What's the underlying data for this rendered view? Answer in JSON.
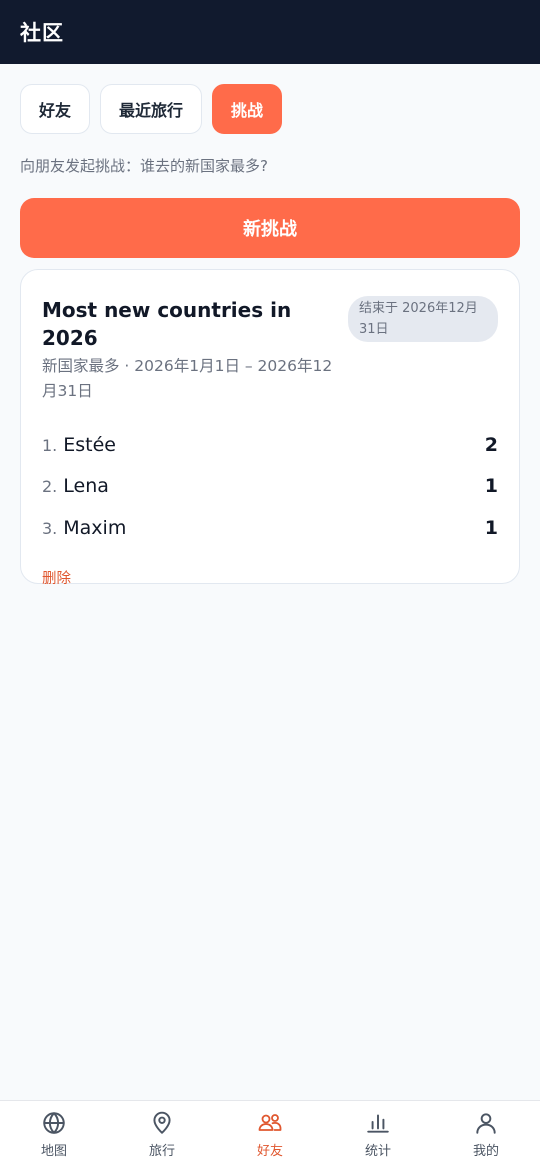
{
  "header": {
    "title": "社区"
  },
  "tabs": [
    {
      "label": "好友"
    },
    {
      "label": "最近旅行"
    },
    {
      "label": "挑战"
    }
  ],
  "prompt": "向朋友发起挑战：谁去的新国家最多?",
  "new_challenge_button": "新挑战",
  "challenge": {
    "title": "Most new countries in 2026",
    "subtitle": "新国家最多 · 2026年1月1日 – 2026年12月31日",
    "end_badge": "结束于 2026年12月31日",
    "leaderboard": [
      {
        "rank": "1.",
        "name": "Estée",
        "score": "2"
      },
      {
        "rank": "2.",
        "name": "Lena",
        "score": "1"
      },
      {
        "rank": "3.",
        "name": "Maxim",
        "score": "1"
      }
    ],
    "delete_label": "删除"
  },
  "bottom_nav": [
    {
      "label": "地图",
      "icon": "globe-icon"
    },
    {
      "label": "旅行",
      "icon": "map-pin-icon"
    },
    {
      "label": "好友",
      "icon": "friends-icon"
    },
    {
      "label": "统计",
      "icon": "bar-chart-icon"
    },
    {
      "label": "我的",
      "icon": "user-icon"
    }
  ],
  "colors": {
    "accent": "#ff6b4a",
    "header_bg": "#111a2e",
    "active_nav": "#e0572f"
  }
}
